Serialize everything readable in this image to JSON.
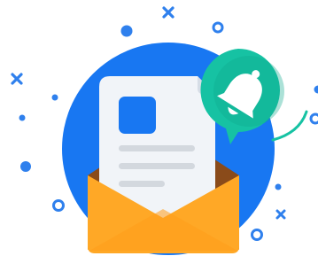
{
  "illustration": {
    "icons": {
      "envelope": "envelope-icon",
      "document": "document-icon",
      "bell": "bell-icon",
      "notification_bubble": "speech-bubble-icon"
    },
    "colors": {
      "background_circle": "#1877f2",
      "decor_blue": "#2f80ed",
      "document_paper": "#f1f4f8",
      "document_fold": "#d6dde6",
      "document_text_lines": "#d3d8de",
      "document_image_block": "#1877f2",
      "envelope_front": "#ffa826",
      "envelope_flap_side": "#f59a1b",
      "envelope_back_dark": "#8a4b1a",
      "notification_teal": "#16c2a3",
      "notification_teal_dark": "#0ea88c",
      "bell_white": "#ffffff"
    }
  }
}
